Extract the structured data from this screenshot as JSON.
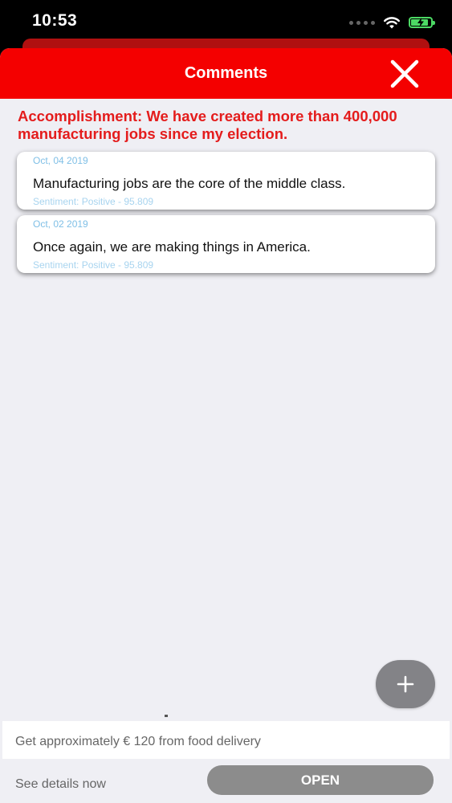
{
  "status_bar": {
    "time": "10:53",
    "battery_color": "#4cd964"
  },
  "header": {
    "title": "Comments",
    "close_icon": "close-icon",
    "background": "#f40000"
  },
  "accomplishment": {
    "text": "Accomplishment: We have created more than 400,000 manufacturing jobs since my election."
  },
  "comments": [
    {
      "date": "Oct, 04 2019",
      "text": "Manufacturing jobs are the core of the middle class.",
      "sentiment": "Sentiment: Positive - 95.809"
    },
    {
      "date": "Oct, 02 2019",
      "text": "Once again, we are making things in America.",
      "sentiment": "Sentiment: Positive - 95.809"
    }
  ],
  "fab": {
    "icon": "plus-icon"
  },
  "ad": {
    "headline": "Get approximately € 120 from food delivery",
    "details": "See details now",
    "button_label": "OPEN"
  }
}
